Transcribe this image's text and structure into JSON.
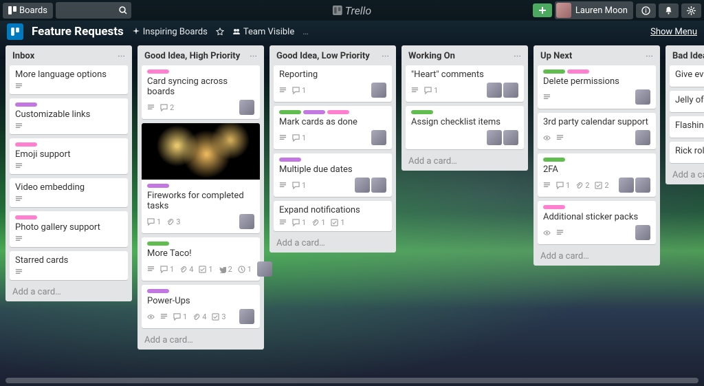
{
  "topbar": {
    "boards_label": "Boards",
    "brand": "Trello",
    "user_name": "Lauren Moon"
  },
  "boardbar": {
    "title": "Feature Requests",
    "inspiring": "Inspiring Boards",
    "visibility": "Team Visible",
    "show_menu": "Show Menu"
  },
  "add_card_label": "Add a card…",
  "lists": [
    {
      "title": "Inbox",
      "cards": [
        {
          "title": "More language options",
          "badges": {
            "desc": true
          }
        },
        {
          "title": "Customizable links",
          "labels": [
            "purple"
          ],
          "badges": {
            "desc": true
          }
        },
        {
          "title": "Emoji support",
          "labels": [
            "pink"
          ],
          "badges": {
            "desc": true
          }
        },
        {
          "title": "Video embedding",
          "badges": {
            "desc": true
          }
        },
        {
          "title": "Photo gallery support",
          "labels": [
            "pink"
          ],
          "badges": {
            "desc": true
          }
        },
        {
          "title": "Starred cards",
          "badges": {
            "desc": true
          }
        }
      ]
    },
    {
      "title": "Good Idea, High Priority",
      "cards": [
        {
          "title": "Card syncing across boards",
          "labels": [
            "pink"
          ],
          "badges": {
            "desc": true,
            "comments": 2
          },
          "members": 1
        },
        {
          "title": "Fireworks for completed tasks",
          "cover": true,
          "labels": [
            "purple"
          ],
          "badges": {
            "comments": 1,
            "attach": 3
          },
          "members": 1
        },
        {
          "title": "More Taco!",
          "labels": [
            "green"
          ],
          "badges": {
            "desc": true,
            "comments": 1,
            "attach": 4,
            "check": 1,
            "tw": 2,
            "other": 1
          },
          "members": 1
        },
        {
          "title": "Power-Ups",
          "labels": [
            "purple"
          ],
          "badges": {
            "eye": true,
            "desc": true,
            "comments": 1,
            "attach": 4,
            "check": 3
          },
          "members": 1
        }
      ]
    },
    {
      "title": "Good Idea, Low Priority",
      "cards": [
        {
          "title": "Reporting",
          "badges": {
            "desc": true,
            "comments": 1
          },
          "members": 1
        },
        {
          "title": "Mark cards as done",
          "labels": [
            "green",
            "purple",
            "pink"
          ],
          "badges": {
            "desc": true,
            "comments": 1
          },
          "members": 1
        },
        {
          "title": "Multiple due dates",
          "labels": [
            "purple"
          ],
          "badges": {
            "desc": true,
            "comments": 1
          },
          "members": 2
        },
        {
          "title": "Expand notifications",
          "badges": {
            "desc": true,
            "comments": 1,
            "attach": 1,
            "check": 1
          }
        }
      ]
    },
    {
      "title": "Working On",
      "cards": [
        {
          "title": "\"Heart\" comments",
          "badges": {
            "desc": true,
            "comments": 1
          },
          "members": 2
        },
        {
          "title": "Assign checklist items",
          "labels": [
            "green"
          ],
          "members": 2
        }
      ]
    },
    {
      "title": "Up Next",
      "cards": [
        {
          "title": "Delete permissions",
          "labels": [
            "green",
            "pink"
          ],
          "badges": {
            "desc": true
          },
          "members": 1
        },
        {
          "title": "3rd party calendar support",
          "badges": {
            "eye": true,
            "desc": true
          },
          "members": 1
        },
        {
          "title": "2FA",
          "labels": [
            "green"
          ],
          "badges": {
            "desc": true,
            "comments": 1,
            "attach": 2,
            "check": 2
          },
          "members": 2
        },
        {
          "title": "Additional sticker packs",
          "labels": [
            "pink"
          ],
          "badges": {
            "eye": true,
            "desc": true
          },
          "members": 1
        }
      ]
    },
    {
      "title": "Bad Idea",
      "cards": [
        {
          "title": "Give everything"
        },
        {
          "title": "Jelly of the mo"
        },
        {
          "title": "Flashing text"
        },
        {
          "title": "Rick roll power"
        }
      ]
    }
  ]
}
